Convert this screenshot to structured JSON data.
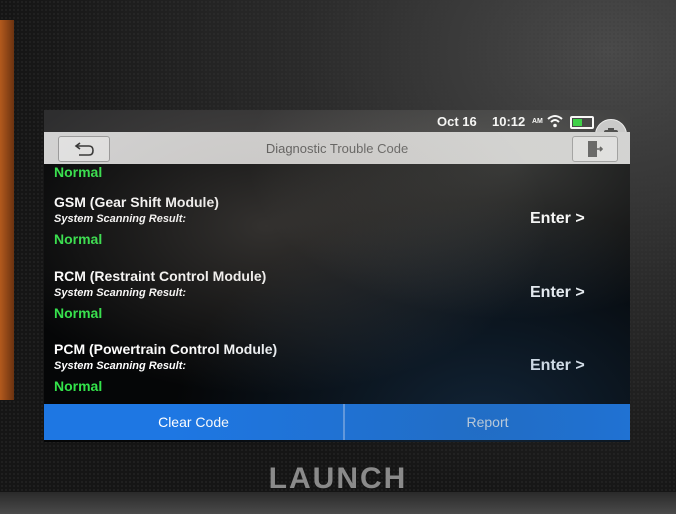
{
  "status": {
    "date": "Oct 16",
    "time": "10:12",
    "ampm": "AM"
  },
  "header": {
    "title": "Diagnostic Trouble Code"
  },
  "content": {
    "cut_status": "Normal",
    "modules": [
      {
        "name": "GSM (Gear Shift Module)",
        "label": "System Scanning Result:",
        "status": "Normal",
        "action": "Enter >"
      },
      {
        "name": "RCM (Restraint Control Module)",
        "label": "System Scanning Result:",
        "status": "Normal",
        "action": "Enter >"
      },
      {
        "name": "PCM (Powertrain Control Module)",
        "label": "System Scanning Result:",
        "status": "Normal",
        "action": "Enter >"
      }
    ]
  },
  "footer": {
    "clear_label": "Clear Code",
    "report_label": "Report"
  },
  "brand": "LAUNCH",
  "colors": {
    "accent": "#1e77e3",
    "status_ok": "#33e34a"
  },
  "icons": [
    "back-arrow-icon",
    "exit-icon",
    "wifi-icon",
    "battery-icon",
    "camera-icon"
  ]
}
